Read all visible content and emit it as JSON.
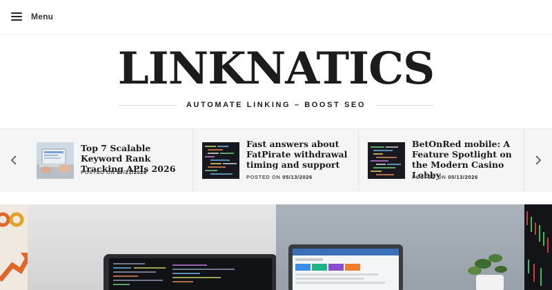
{
  "header": {
    "menu_label": "Menu"
  },
  "branding": {
    "site_title": "LINKNATICS",
    "tagline": "AUTOMATE LINKING – BOOST SEO"
  },
  "ticker": {
    "items": [
      {
        "title": "Top 7 Scalable Keyword Rank Tracking APIs 2026",
        "posted_prefix": "POSTED ON",
        "date": "07/21/2026",
        "thumb_icon": "laptop-photo"
      },
      {
        "title": "Fast answers about FatPirate withdrawal timing and support",
        "posted_prefix": "POSTED ON",
        "date": "05/13/2026",
        "thumb_icon": "code-screen-photo"
      },
      {
        "title": "BetOnRed mobile: A Feature Spotlight on the Modern Casino Lobby",
        "posted_prefix": "POSTED ON",
        "date": "05/13/2026",
        "thumb_icon": "code-screen-photo"
      }
    ]
  },
  "colors": {
    "accent_dark": "#1c1c1c",
    "ticker_bg": "#f5f5f5"
  }
}
